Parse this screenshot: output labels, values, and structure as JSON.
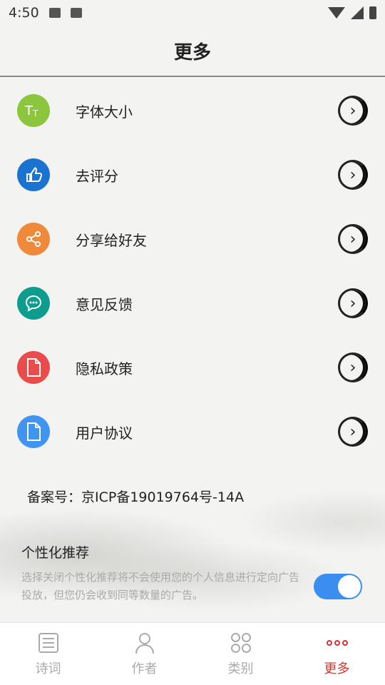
{
  "status_bar": {
    "time": "4:50"
  },
  "header": {
    "title": "更多"
  },
  "menu": [
    {
      "label": "字体大小",
      "icon": "font-size-icon",
      "color": "#8cc63f"
    },
    {
      "label": "去评分",
      "icon": "thumbs-up-icon",
      "color": "#1a73d1"
    },
    {
      "label": "分享给好友",
      "icon": "share-icon",
      "color": "#f08a3a"
    },
    {
      "label": "意见反馈",
      "icon": "feedback-chat-icon",
      "color": "#0e9c8e"
    },
    {
      "label": "隐私政策",
      "icon": "document-icon",
      "color": "#ea4b4b"
    },
    {
      "label": "用户协议",
      "icon": "document-icon",
      "color": "#3f95f0"
    }
  ],
  "icp": "备案号：京ICP备19019764号-14A",
  "personal": {
    "title": "个性化推荐",
    "desc": "选择关闭个性化推荐将不会使用您的个人信息进行定向广告投放，但您仍会收到同等数量的广告。",
    "enabled": true,
    "accent": "#3a8ef0"
  },
  "tabs": [
    {
      "label": "诗词",
      "icon": "poem-icon",
      "active": false
    },
    {
      "label": "作者",
      "icon": "author-icon",
      "active": false
    },
    {
      "label": "类别",
      "icon": "category-icon",
      "active": false
    },
    {
      "label": "更多",
      "icon": "more-icon",
      "active": true
    }
  ],
  "colors": {
    "active_tab": "#d9332b",
    "inactive_tab": "#aaaaaa"
  }
}
